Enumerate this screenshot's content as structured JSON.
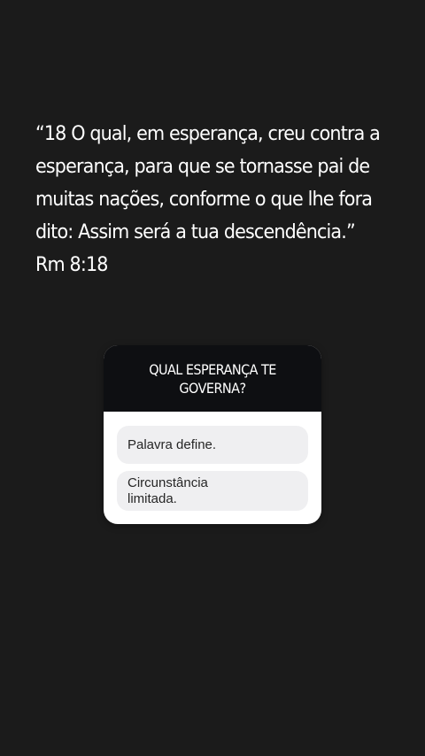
{
  "story": {
    "quote": "“18 O qual, em esperança, creu contra a\nesperança, para que se tornasse pai de\nmuitas nações, conforme o que lhe fora\ndito: Assim será a tua descendência.”\nRm 8:18"
  },
  "quiz": {
    "question": "QUAL ESPERANÇA TE GOVERNA?",
    "options": [
      {
        "label": "Palavra define."
      },
      {
        "label": "Circunstância limitada."
      }
    ]
  },
  "colors": {
    "background": "#1b1b1b",
    "quiz_header": "#0e0f12",
    "option_bg": "#efeff1"
  }
}
